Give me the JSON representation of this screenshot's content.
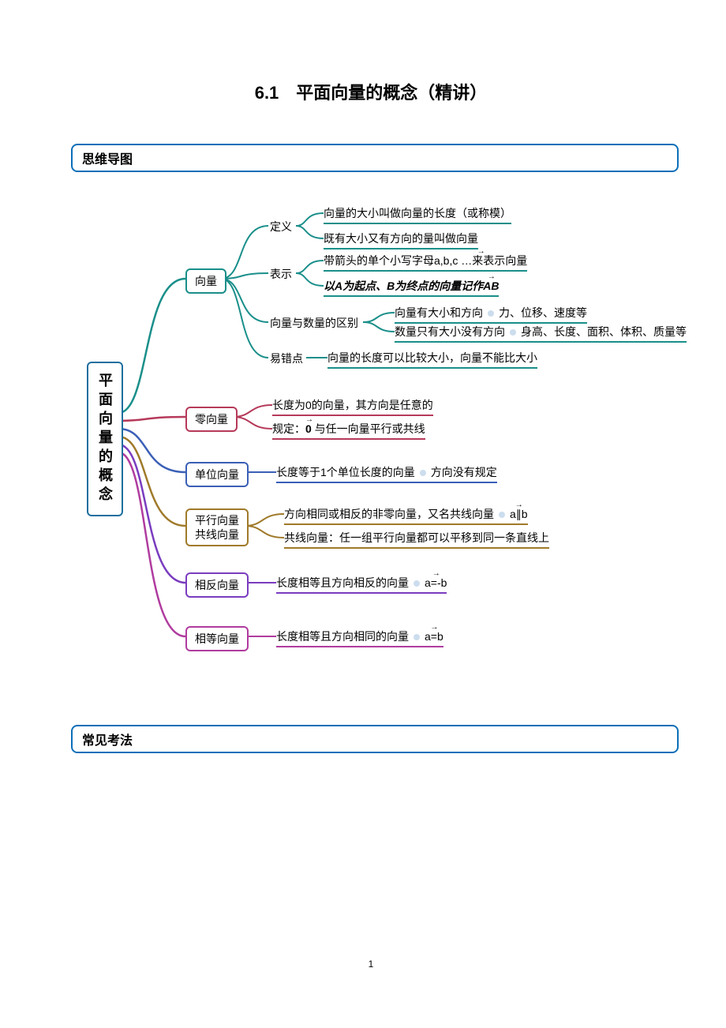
{
  "title": "6.1　平面向量的概念（精讲）",
  "section_mindmap": "思维导图",
  "section_exam": "常见考法",
  "page_number": "1",
  "root": "平面向量的概念",
  "colors": {
    "teal": "#1a8f8a",
    "red": "#b63a5a",
    "blue": "#3a5fb6",
    "brown": "#a07a2a",
    "violet": "#7a3cbf",
    "magenta": "#b03c9f"
  },
  "nodes": {
    "vector": "向量",
    "zero": "零向量",
    "unit": "单位向量",
    "parallel1": "平行向量",
    "parallel2": "共线向量",
    "opposite": "相反向量",
    "equal": "相等向量",
    "def": "定义",
    "repr": "表示",
    "diff": "向量与数量的区别",
    "mistake": "易错点"
  },
  "leaves": {
    "l1": "向量的大小叫做向量的长度（或称模）",
    "l2": "既有大小又有方向的量叫做向量",
    "l3a": "带箭头的单个小写字母",
    "l3b": "a,b,c …来表示向量",
    "l4a": "以A为起点、B为终点的向量记作",
    "l4b": "AB",
    "l5": "向量有大小和方向",
    "l5b": "力、位移、速度等",
    "l6": "数量只有大小没有方向",
    "l6b": "身高、长度、面积、体积、质量等",
    "l7": "向量的长度可以比较大小，向量不能比大小",
    "l8": "长度为0的向量，其方向是任意的",
    "l9a": "规定：",
    "l9b": "0",
    "l9c": " 与任一向量平行或共线",
    "l10": "长度等于1个单位长度的向量",
    "l10b": "方向没有规定",
    "l11": "方向相同或相反的非零向量，又名共线向量",
    "l11b": "a∥b",
    "l12": "共线向量：任一组平行向量都可以平移到同一条直线上",
    "l13": "长度相等且方向相反的向量",
    "l13b": "a=-b",
    "l14": "长度相等且方向相同的向量",
    "l14b": "a=b"
  }
}
